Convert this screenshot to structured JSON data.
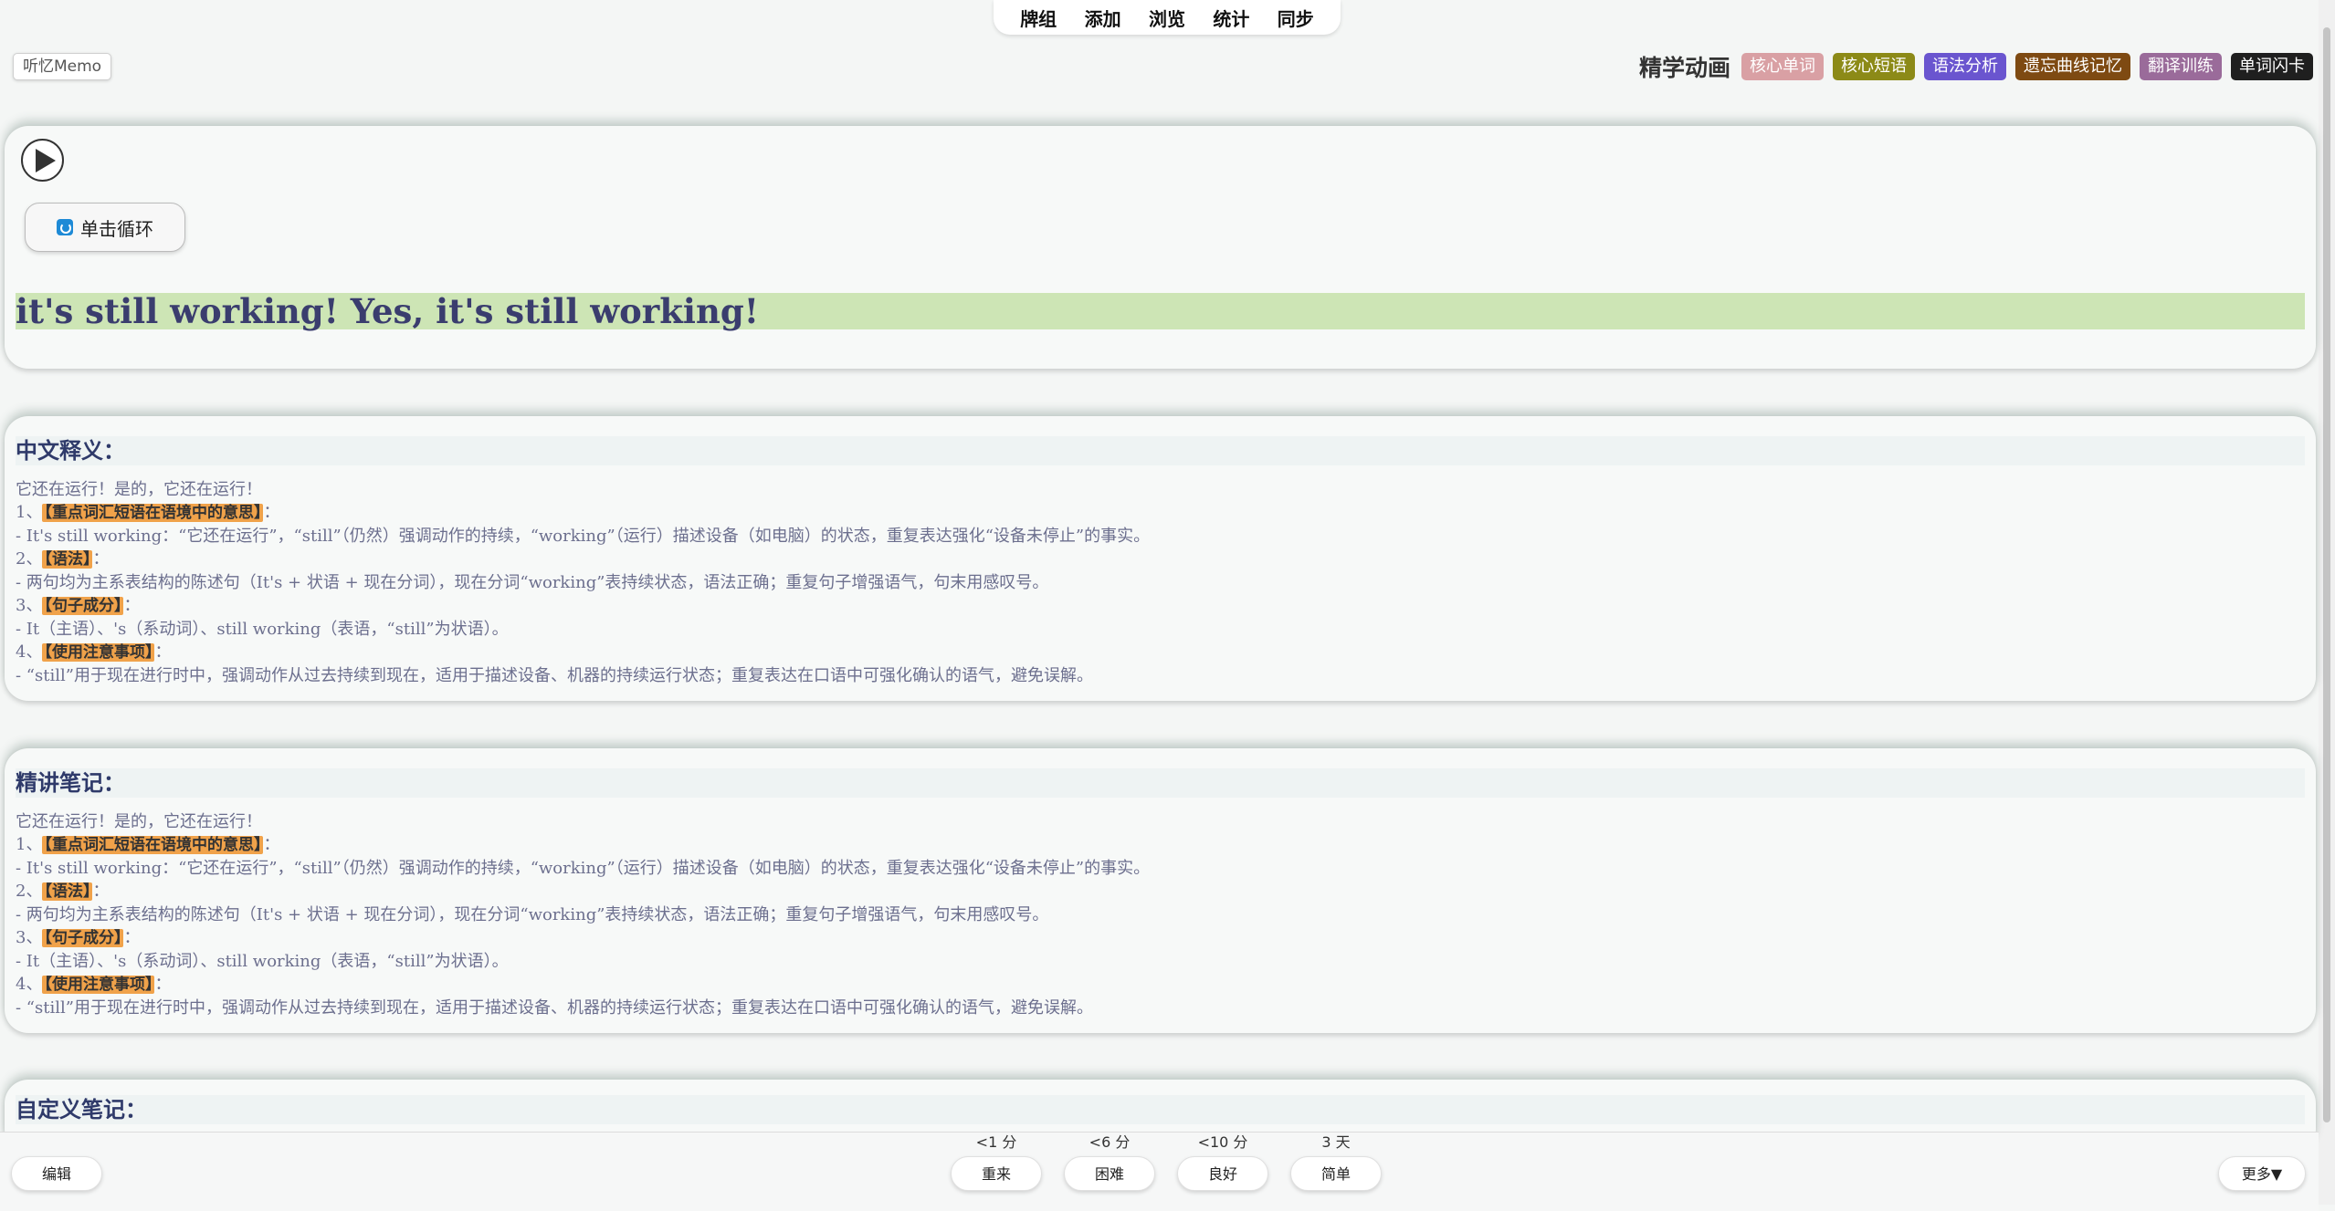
{
  "top_menu": [
    "牌组",
    "添加",
    "浏览",
    "统计",
    "同步"
  ],
  "app_label": "听忆Memo",
  "tagbar": {
    "title": "精学动画",
    "tags": [
      {
        "label": "核心单词",
        "color": "#d9a0a4"
      },
      {
        "label": "核心短语",
        "color": "#8c8a17"
      },
      {
        "label": "语法分析",
        "color": "#6a55cf"
      },
      {
        "label": "遗忘曲线记忆",
        "color": "#7e4a12"
      },
      {
        "label": "翻译训练",
        "color": "#9a6b9a"
      },
      {
        "label": "单词闪卡",
        "color": "#1f1f1f"
      }
    ]
  },
  "player": {
    "loop_label": "单击循环",
    "sentence": "it's still working! Yes, it's still working!"
  },
  "sections": [
    {
      "title": "中文释义：",
      "translation": "它还在运行！是的，它还在运行！",
      "items": [
        {
          "num": "1、",
          "tag": "【重点词汇短语在语境中的意思】",
          "detail": "- It's still working：“它还在运行”，“still”（仍然）强调动作的持续，“working”（运行）描述设备（如电脑）的状态，重复表达强化“设备未停止”的事实。"
        },
        {
          "num": "2、",
          "tag": "【语法】",
          "detail": "- 两句均为主系表结构的陈述句（It's + 状语 + 现在分词），现在分词“working”表持续状态，语法正确；重复句子增强语气，句末用感叹号。"
        },
        {
          "num": "3、",
          "tag": "【句子成分】",
          "detail": "- It（主语）、's（系动词）、still working（表语，“still”为状语）。"
        },
        {
          "num": "4、",
          "tag": "【使用注意事项】",
          "detail": "- “still”用于现在进行时中，强调动作从过去持续到现在，适用于描述设备、机器的持续运行状态；重复表达在口语中可强化确认的语气，避免误解。"
        }
      ]
    },
    {
      "title": "精讲笔记：",
      "translation": "它还在运行！是的，它还在运行！",
      "items": [
        {
          "num": "1、",
          "tag": "【重点词汇短语在语境中的意思】",
          "detail": "- It's still working：“它还在运行”，“still”（仍然）强调动作的持续，“working”（运行）描述设备（如电脑）的状态，重复表达强化“设备未停止”的事实。"
        },
        {
          "num": "2、",
          "tag": "【语法】",
          "detail": "- 两句均为主系表结构的陈述句（It's + 状语 + 现在分词），现在分词“working”表持续状态，语法正确；重复句子增强语气，句末用感叹号。"
        },
        {
          "num": "3、",
          "tag": "【句子成分】",
          "detail": "- It（主语）、's（系动词）、still working（表语，“still”为状语）。"
        },
        {
          "num": "4、",
          "tag": "【使用注意事项】",
          "detail": "- “still”用于现在进行时中，强调动作从过去持续到现在，适用于描述设备、机器的持续运行状态；重复表达在口语中可强化确认的语气，避免误解。"
        }
      ]
    },
    {
      "title": "自定义笔记："
    }
  ],
  "bottom_bar": {
    "edit_label": "编辑",
    "more_label": "更多▼",
    "answers": [
      {
        "interval": "<1 分",
        "label": "重来"
      },
      {
        "interval": "<6 分",
        "label": "困难"
      },
      {
        "interval": "<10 分",
        "label": "良好"
      },
      {
        "interval": "3 天",
        "label": "简单"
      }
    ]
  }
}
